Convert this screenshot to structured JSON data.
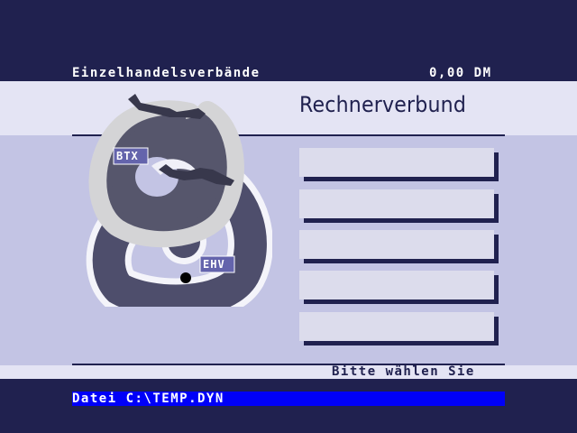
{
  "header": {
    "left_text": "Einzelhandelsverbände",
    "right_text": "0,00 DM"
  },
  "title": "Rechnerverbund",
  "menu": {
    "buttons": [
      "",
      "",
      "",
      "",
      ""
    ]
  },
  "logo": {
    "label_top": "BTX",
    "label_bottom": "EHV"
  },
  "status": "Bitte wählen Sie",
  "file": "Datei C:\\TEMP.DYN",
  "colors": {
    "background_dark": "#20214f",
    "band_light": "#e4e4f4",
    "main_panel": "#c3c4e4",
    "button_face": "#dcdcec",
    "file_bar": "#0000f8"
  }
}
